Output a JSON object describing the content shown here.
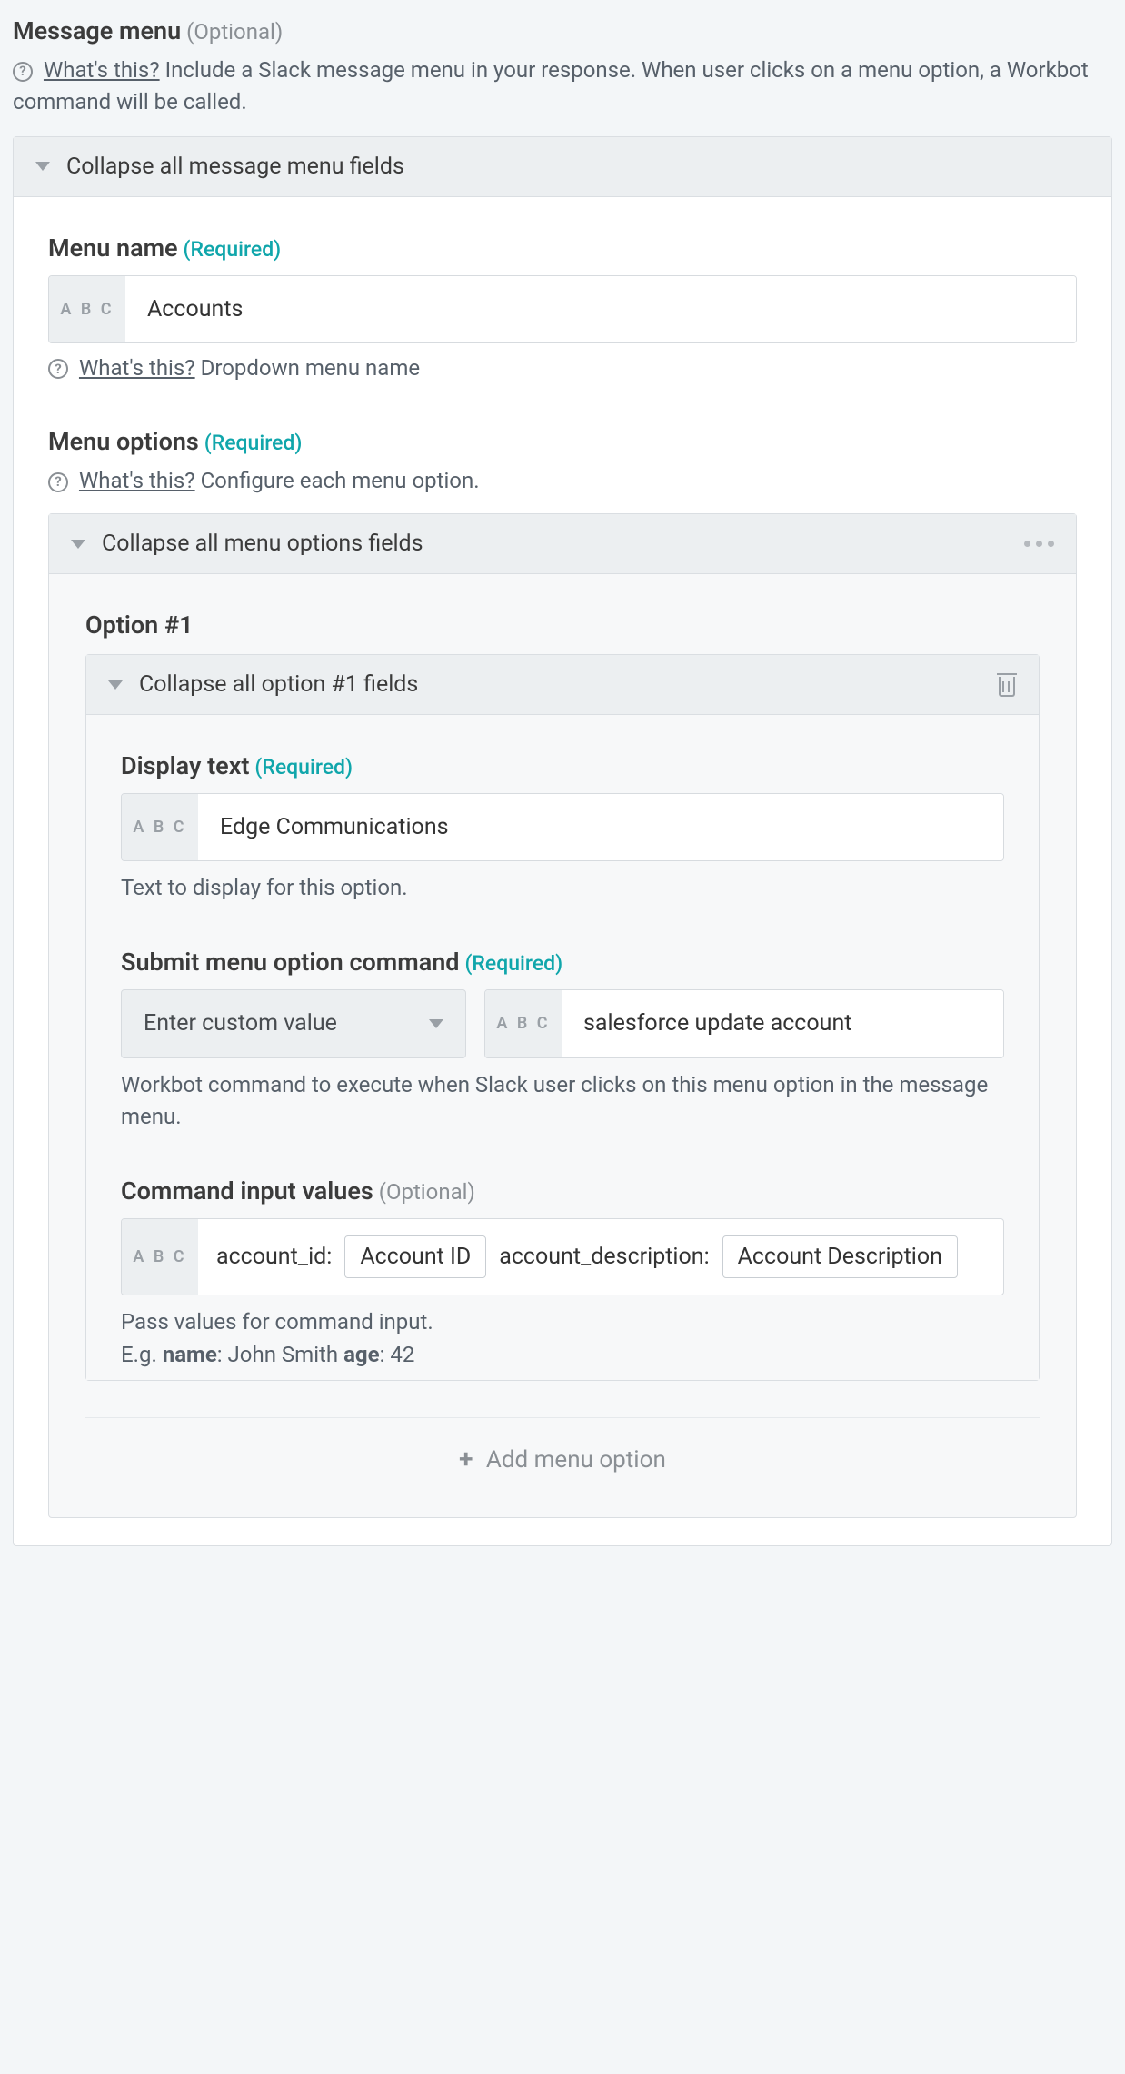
{
  "header": {
    "title": "Message menu",
    "tag": "(Optional)",
    "whats_this": "What's this?",
    "description": "Include a Slack message menu in your response. When user clicks on a menu option, a Workbot command will be called."
  },
  "panel": {
    "collapse_label": "Collapse all message menu fields"
  },
  "menu_name": {
    "label": "Menu name",
    "tag": "(Required)",
    "abc": "A B C",
    "value": "Accounts",
    "whats_this": "What's this?",
    "hint": "Dropdown menu name"
  },
  "menu_options": {
    "label": "Menu options",
    "tag": "(Required)",
    "whats_this": "What's this?",
    "hint": "Configure each menu option.",
    "collapse_label": "Collapse all menu options fields"
  },
  "option1": {
    "title": "Option #1",
    "collapse_label": "Collapse all option #1 fields",
    "display_text": {
      "label": "Display text",
      "tag": "(Required)",
      "abc": "A B C",
      "value": "Edge Communications",
      "hint": "Text to display for this option."
    },
    "submit": {
      "label": "Submit menu option command",
      "tag": "(Required)",
      "select_value": "Enter custom value",
      "abc": "A B C",
      "value": "salesforce update account",
      "hint": "Workbot command to execute when Slack user clicks on this menu option in the message menu."
    },
    "command_input": {
      "label": "Command input values",
      "tag": "(Optional)",
      "abc": "A B C",
      "text1": "account_id:",
      "token1": "Account ID",
      "text2": "account_description:",
      "token2": "Account Description",
      "hint1": "Pass values for command input.",
      "hint2a": "E.g. ",
      "hint2b": "name",
      "hint2c": ": John Smith ",
      "hint2d": "age",
      "hint2e": ": 42"
    }
  },
  "add_option": "Add menu option"
}
